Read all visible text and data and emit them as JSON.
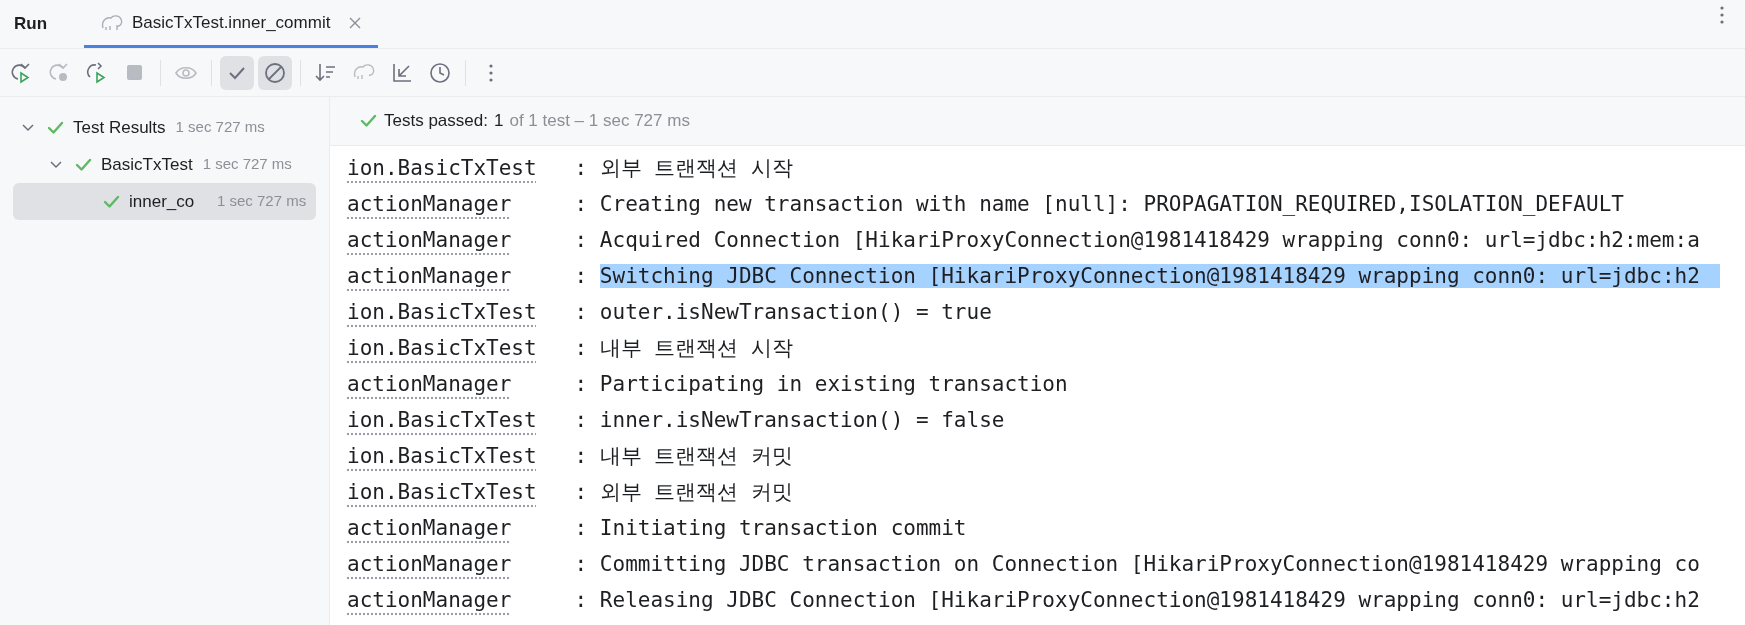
{
  "header": {
    "title": "Run",
    "tabs": [
      {
        "label": "BasicTxTest.inner_commit",
        "selected": true
      }
    ]
  },
  "toolbar": {
    "buttons": [
      {
        "kind": "rerun",
        "disabled": false,
        "pressed": false
      },
      {
        "kind": "rerun-failed",
        "disabled": true,
        "pressed": false
      },
      {
        "kind": "toggle-auto",
        "disabled": false,
        "pressed": false
      },
      {
        "kind": "stop",
        "disabled": true,
        "pressed": false
      },
      {
        "kind": "sep"
      },
      {
        "kind": "eye",
        "disabled": true,
        "pressed": false
      },
      {
        "kind": "sep"
      },
      {
        "kind": "check",
        "disabled": false,
        "pressed": true
      },
      {
        "kind": "ignored",
        "disabled": false,
        "pressed": true
      },
      {
        "kind": "sep"
      },
      {
        "kind": "sort",
        "disabled": false,
        "pressed": false
      },
      {
        "kind": "import",
        "disabled": true,
        "pressed": false
      },
      {
        "kind": "collapse",
        "disabled": false,
        "pressed": false
      },
      {
        "kind": "history",
        "disabled": false,
        "pressed": false
      },
      {
        "kind": "sep"
      },
      {
        "kind": "more",
        "disabled": false,
        "pressed": false
      }
    ]
  },
  "tree": [
    {
      "label": "Test Results",
      "time": "1 sec 727 ms",
      "expanded": true,
      "selected": false,
      "children": [
        {
          "label": "BasicTxTest",
          "time": "1 sec 727 ms",
          "expanded": true,
          "selected": false,
          "children": [
            {
              "label": "inner_co",
              "time": "1 sec 727 ms",
              "selected": true
            }
          ]
        }
      ]
    }
  ],
  "status": {
    "label": "Tests passed:",
    "count": "1",
    "rest": "of 1 test – 1 sec 727 ms"
  },
  "console": [
    {
      "logger": "ion.BasicTxTest",
      "message": ": 외부 트랜잭션 시작",
      "selected": false
    },
    {
      "logger": "actionManager",
      "message": ": Creating new transaction with name [null]: PROPAGATION_REQUIRED,ISOLATION_DEFAULT",
      "selected": false
    },
    {
      "logger": "actionManager",
      "message": ": Acquired Connection [HikariProxyConnection@1981418429 wrapping conn0: url=jdbc:h2:mem:a",
      "selected": false
    },
    {
      "logger": "actionManager",
      "message": ": Switching JDBC Connection [HikariProxyConnection@1981418429 wrapping conn0: url=jdbc:h2",
      "selected": true
    },
    {
      "logger": "ion.BasicTxTest",
      "message": ": outer.isNewTransaction() = true",
      "selected": false
    },
    {
      "logger": "ion.BasicTxTest",
      "message": ": 내부 트랜잭션 시작",
      "selected": false
    },
    {
      "logger": "actionManager",
      "message": ": Participating in existing transaction",
      "selected": false
    },
    {
      "logger": "ion.BasicTxTest",
      "message": ": inner.isNewTransaction() = false",
      "selected": false
    },
    {
      "logger": "ion.BasicTxTest",
      "message": ": 내부 트랜잭션 커밋",
      "selected": false
    },
    {
      "logger": "ion.BasicTxTest",
      "message": ": 외부 트랜잭션 커밋",
      "selected": false
    },
    {
      "logger": "actionManager",
      "message": ": Initiating transaction commit",
      "selected": false
    },
    {
      "logger": "actionManager",
      "message": ": Committing JDBC transaction on Connection [HikariProxyConnection@1981418429 wrapping co",
      "selected": false
    },
    {
      "logger": "actionManager",
      "message": ": Releasing JDBC Connection [HikariProxyConnection@1981418429 wrapping conn0: url=jdbc:h2",
      "selected": false
    }
  ]
}
